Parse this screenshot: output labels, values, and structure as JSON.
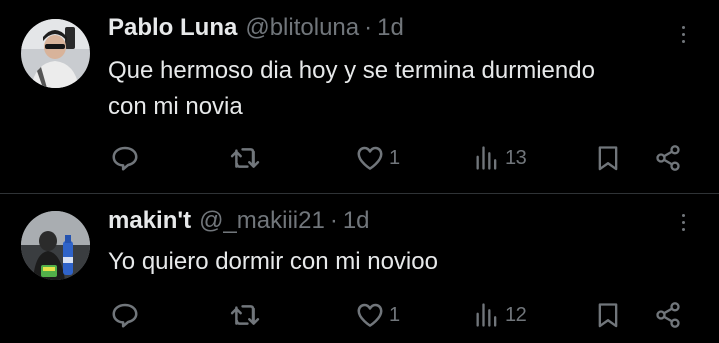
{
  "posts": [
    {
      "name": "Pablo Luna",
      "handle": "@blitoluna",
      "separator": "·",
      "time": "1d",
      "text_lines": [
        "Que hermoso dia hoy y se termina durmiendo",
        "con mi novia"
      ],
      "avatar_icon": "profile-photo",
      "actions": {
        "reply_count": "",
        "retweet_count": "",
        "like_count": "1",
        "views_count": "13"
      }
    },
    {
      "name": "makin't",
      "handle": "@_makiii21",
      "separator": "·",
      "time": "1d",
      "text_lines": [
        "Yo quiero dormir con mi novioo"
      ],
      "avatar_icon": "profile-photo",
      "actions": {
        "reply_count": "",
        "retweet_count": "",
        "like_count": "1",
        "views_count": "12"
      }
    }
  ],
  "colors": {
    "background": "#000000",
    "primary_text": "#e7e9ea",
    "secondary_text": "#71767b",
    "divider": "#2f3336"
  },
  "icons": [
    "reply-icon",
    "retweet-icon",
    "like-icon",
    "views-icon",
    "bookmark-icon",
    "share-icon",
    "more-icon"
  ]
}
